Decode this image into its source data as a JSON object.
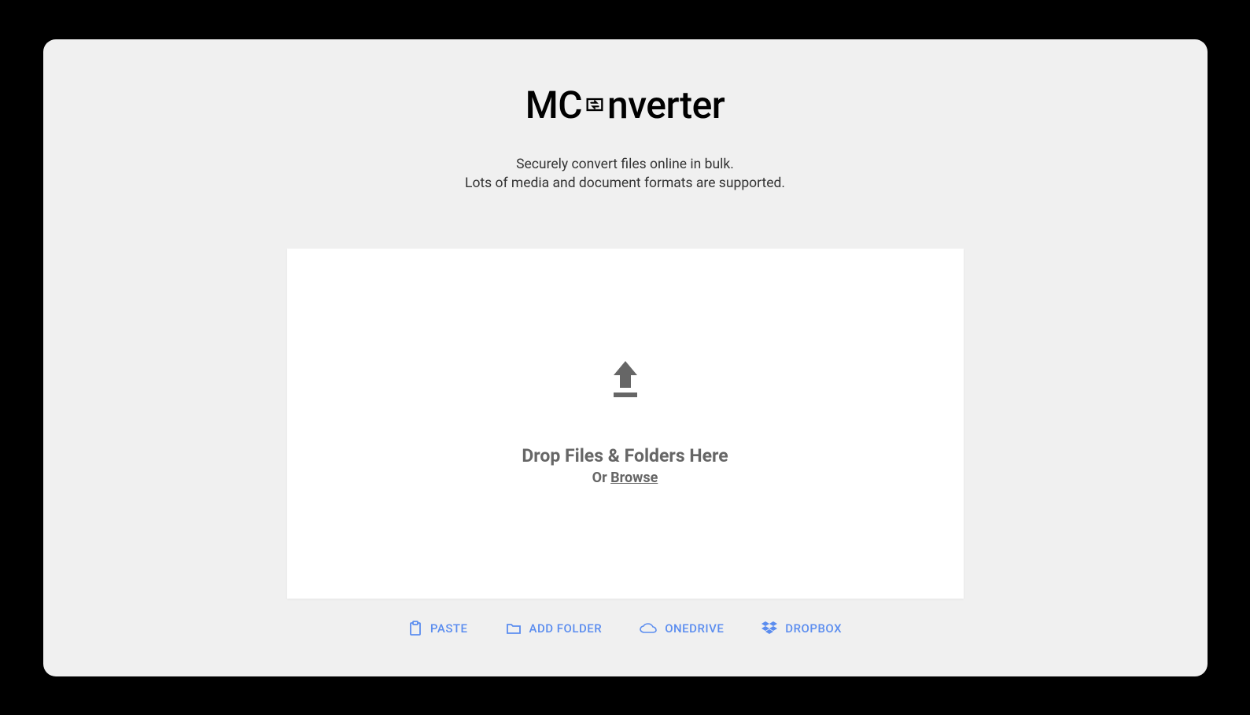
{
  "logo": {
    "prefix": "MC",
    "suffix": "nverter"
  },
  "tagline": {
    "line1": "Securely convert files online in bulk.",
    "line2": "Lots of media and document formats are supported."
  },
  "dropzone": {
    "main_text": "Drop Files & Folders Here",
    "or_text": "Or ",
    "browse_text": "Browse"
  },
  "buttons": {
    "paste": "PASTE",
    "add_folder": "ADD FOLDER",
    "onedrive": "ONEDRIVE",
    "dropbox": "DROPBOX"
  },
  "colors": {
    "accent": "#5b8def",
    "text_muted": "#666",
    "upload_icon": "#666"
  }
}
